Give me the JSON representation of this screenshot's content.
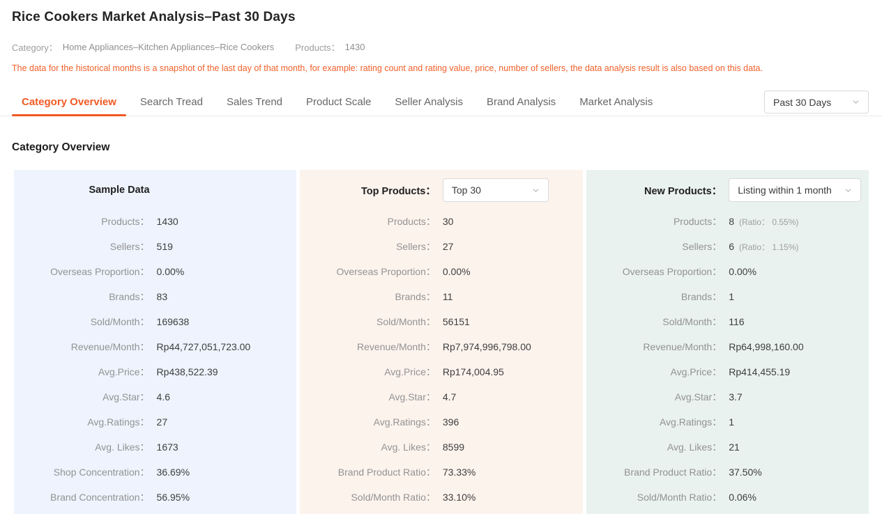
{
  "header": {
    "title": "Rice Cookers Market Analysis–Past 30 Days",
    "category_label": "Category：",
    "category_value": "Home Appliances–Kitchen Appliances–Rice Cookers",
    "products_label": "Products：",
    "products_value": "1430",
    "note": "The data for the historical months is a snapshot of the last day of that month, for example: rating count and rating value, price, number of sellers, the data analysis result is also based on this data."
  },
  "tabs": [
    {
      "label": "Category Overview",
      "active": true
    },
    {
      "label": "Search Tread",
      "active": false
    },
    {
      "label": "Sales Trend",
      "active": false
    },
    {
      "label": "Product Scale",
      "active": false
    },
    {
      "label": "Seller Analysis",
      "active": false
    },
    {
      "label": "Brand Analysis",
      "active": false
    },
    {
      "label": "Market Analysis",
      "active": false
    }
  ],
  "period_selector": {
    "value": "Past 30 Days"
  },
  "section_title": "Category Overview",
  "colors": {
    "accent": "#f05a23",
    "note": "#f0602a",
    "sample_panel_bg": "#eef3fd",
    "top_products_panel_bg": "#fdf3ed",
    "new_products_panel_bg": "#e9f2ee"
  },
  "panels": [
    {
      "name": "sample-data",
      "header_label": "Sample Data",
      "bg": "#eef3fd",
      "rows": [
        {
          "label": "Products：",
          "value": "1430"
        },
        {
          "label": "Sellers：",
          "value": "519"
        },
        {
          "label": "Overseas Proportion：",
          "value": "0.00%"
        },
        {
          "label": "Brands：",
          "value": "83"
        },
        {
          "label": "Sold/Month：",
          "value": "169638"
        },
        {
          "label": "Revenue/Month：",
          "value": "Rp44,727,051,723.00"
        },
        {
          "label": "Avg.Price：",
          "value": "Rp438,522.39"
        },
        {
          "label": "Avg.Star：",
          "value": "4.6"
        },
        {
          "label": "Avg.Ratings：",
          "value": "27"
        },
        {
          "label": "Avg. Likes：",
          "value": "1673"
        },
        {
          "label": "Shop Concentration：",
          "value": "36.69%"
        },
        {
          "label": "Brand Concentration：",
          "value": "56.95%"
        }
      ]
    },
    {
      "name": "top-products",
      "header_label": "Top Products：",
      "dropdown_value": "Top 30",
      "bg": "#fdf3ed",
      "rows": [
        {
          "label": "Products：",
          "value": "30"
        },
        {
          "label": "Sellers：",
          "value": "27"
        },
        {
          "label": "Overseas Proportion：",
          "value": "0.00%"
        },
        {
          "label": "Brands：",
          "value": "11"
        },
        {
          "label": "Sold/Month：",
          "value": "56151"
        },
        {
          "label": "Revenue/Month：",
          "value": "Rp7,974,996,798.00"
        },
        {
          "label": "Avg.Price：",
          "value": "Rp174,004.95"
        },
        {
          "label": "Avg.Star：",
          "value": "4.7"
        },
        {
          "label": "Avg.Ratings：",
          "value": "396"
        },
        {
          "label": "Avg. Likes：",
          "value": "8599"
        },
        {
          "label": "Brand Product Ratio：",
          "value": "73.33%"
        },
        {
          "label": "Sold/Month Ratio：",
          "value": "33.10%"
        }
      ]
    },
    {
      "name": "new-products",
      "header_label": "New Products：",
      "dropdown_value": "Listing within 1 month",
      "bg": "#e9f2ee",
      "rows": [
        {
          "label": "Products：",
          "value": "8",
          "ratio": "(Ratio： 0.55%)"
        },
        {
          "label": "Sellers：",
          "value": "6",
          "ratio": "(Ratio： 1.15%)"
        },
        {
          "label": "Overseas Proportion：",
          "value": "0.00%"
        },
        {
          "label": "Brands：",
          "value": "1"
        },
        {
          "label": "Sold/Month：",
          "value": "116"
        },
        {
          "label": "Revenue/Month：",
          "value": "Rp64,998,160.00"
        },
        {
          "label": "Avg.Price：",
          "value": "Rp414,455.19"
        },
        {
          "label": "Avg.Star：",
          "value": "3.7"
        },
        {
          "label": "Avg.Ratings：",
          "value": "1"
        },
        {
          "label": "Avg. Likes：",
          "value": "21"
        },
        {
          "label": "Brand Product Ratio：",
          "value": "37.50%"
        },
        {
          "label": "Sold/Month Ratio：",
          "value": "0.06%"
        }
      ]
    }
  ]
}
